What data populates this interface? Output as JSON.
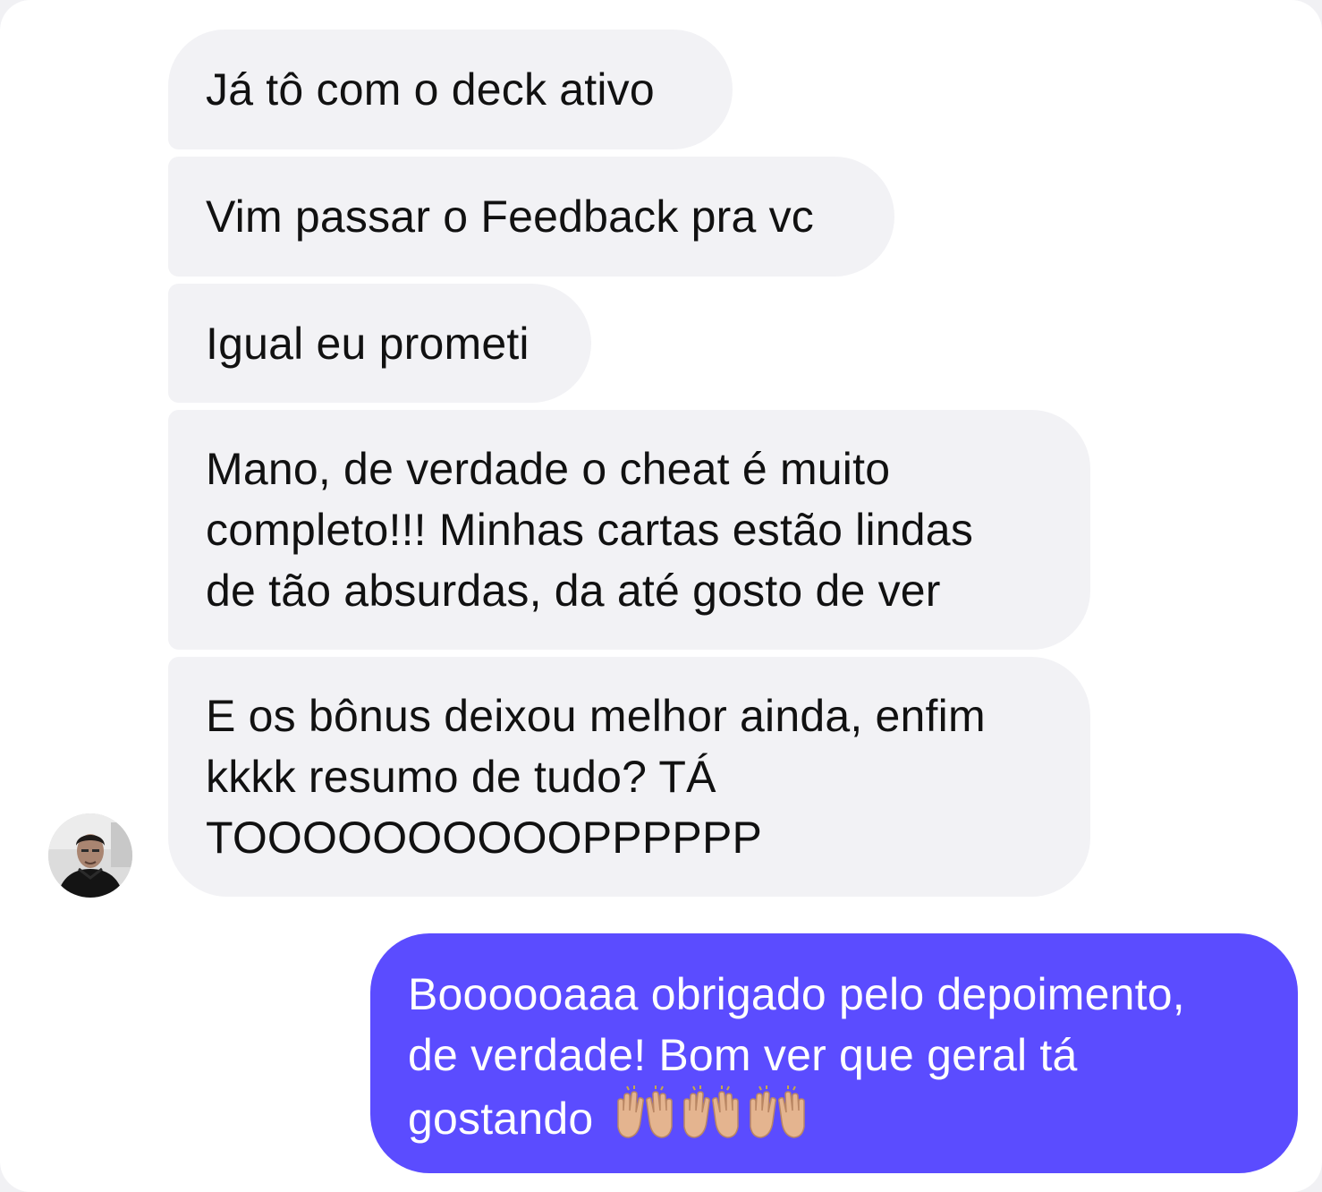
{
  "conversation": {
    "incoming": [
      {
        "lines": [
          "Já tô com o deck ativo"
        ]
      },
      {
        "lines": [
          "Vim passar o Feedback pra vc"
        ]
      },
      {
        "lines": [
          "Igual eu prometi"
        ]
      },
      {
        "lines": [
          "Mano, de verdade o cheat é muito",
          "completo!!! Minhas cartas estão lindas",
          "de tão absurdas, da até gosto de ver"
        ]
      },
      {
        "lines": [
          "E os bônus deixou melhor ainda, enfim",
          "kkkk resumo de tudo? TÁ",
          "TOOOOOOOOOOPPPPPP"
        ]
      }
    ],
    "outgoing": {
      "lines": [
        "Boooooaaa obrigado pelo depoimento,",
        "de verdade! Bom ver que geral tá",
        "gostando"
      ],
      "emoji": "🙌🏼🙌🏼🙌🏼"
    }
  },
  "colors": {
    "incoming_bubble": "#f2f2f5",
    "outgoing_bubble": "#5b4cff",
    "incoming_text": "#111111",
    "outgoing_text": "#ffffff"
  },
  "icons": {
    "avatar": "user-avatar-photo",
    "emoji": "raising-hands-emoji"
  }
}
